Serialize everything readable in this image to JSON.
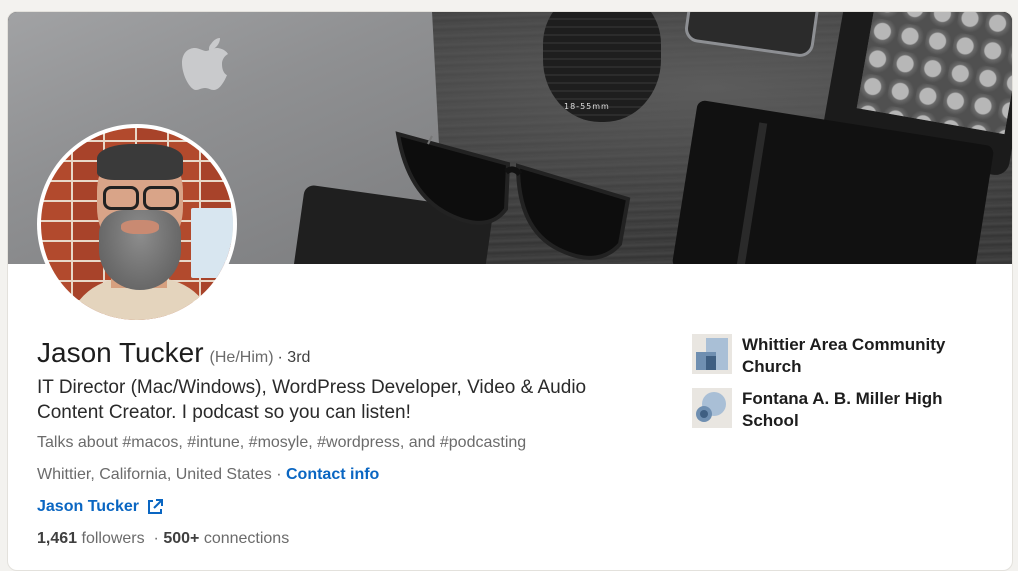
{
  "profile": {
    "name": "Jason Tucker",
    "pronouns": "(He/Him)",
    "degree": "· 3rd",
    "headline": "IT Director (Mac/Windows), WordPress Developer, Video & Audio Content Creator. I podcast so you can listen!",
    "talks_about": "Talks about #macos, #intune, #mosyle, #wordpress, and #podcasting",
    "location": "Whittier, California, United States",
    "location_separator": "·",
    "contact_info": "Contact info",
    "website_label": "Jason Tucker",
    "followers_count": "1,461",
    "followers_label": "followers",
    "stats_separator": "·",
    "connections_count": "500+",
    "connections_label": "connections"
  },
  "organizations": [
    {
      "name": "Whittier Area Community Church",
      "icon": "company-logo-icon"
    },
    {
      "name": "Fontana A. B. Miller High School",
      "icon": "school-logo-icon"
    }
  ],
  "banner": {
    "lens_text": "18-55mm"
  },
  "colors": {
    "link": "#0a66c2",
    "text": "#1d1d1d",
    "muted": "#6b6b6b",
    "card": "#ffffff",
    "page": "#f3f2ef"
  }
}
